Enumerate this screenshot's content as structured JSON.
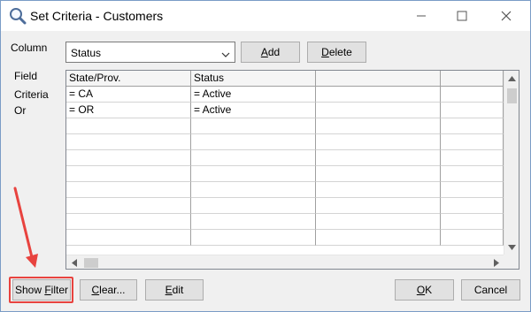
{
  "window": {
    "title": "Set Criteria - Customers",
    "icons": [
      "search-icon",
      "minimize-icon",
      "maximize-icon",
      "close-icon"
    ]
  },
  "column": {
    "label": "Column",
    "selected": "Status"
  },
  "buttons": {
    "add_prefix": "",
    "add_u": "A",
    "add_rest": "dd",
    "delete_u": "D",
    "delete_rest": "elete",
    "show_filter_prefix": "Show ",
    "show_filter_u": "F",
    "show_filter_rest": "ilter",
    "clear_u": "C",
    "clear_rest": "lear...",
    "edit_u": "E",
    "edit_rest": "dit",
    "ok_u": "O",
    "ok_rest": "K",
    "cancel": "Cancel"
  },
  "row_labels": {
    "field": "Field",
    "criteria": "Criteria",
    "or": "Or"
  },
  "grid": {
    "headers": [
      "State/Prov.",
      "Status",
      "",
      ""
    ],
    "rows": [
      [
        "= CA",
        "= Active",
        "",
        ""
      ],
      [
        "= OR",
        "= Active",
        "",
        ""
      ]
    ]
  },
  "accent": "#e8433f"
}
